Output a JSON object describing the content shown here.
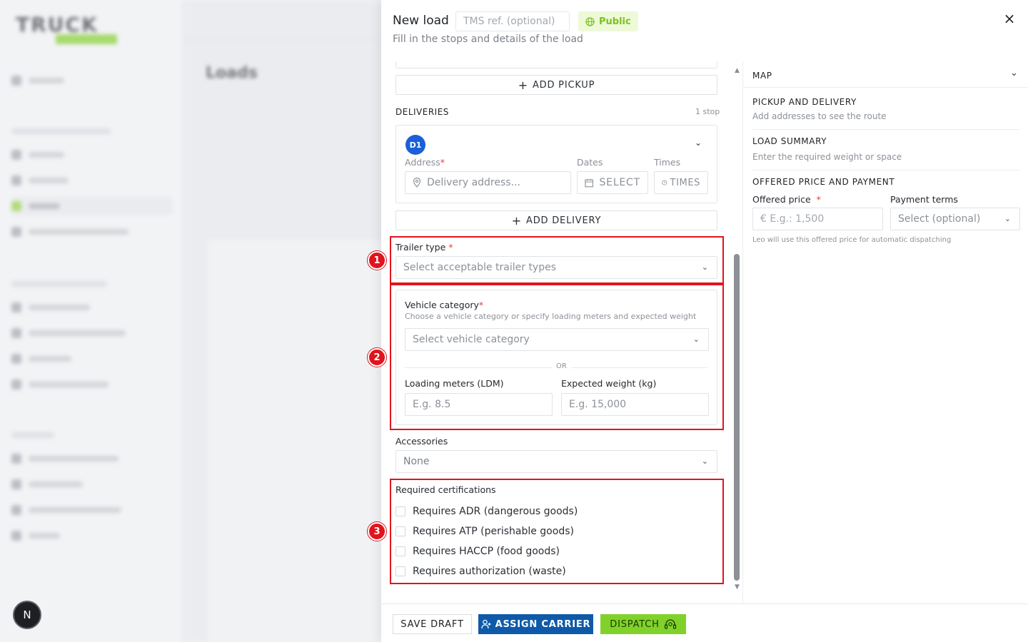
{
  "drawer": {
    "title": "New load",
    "tms_placeholder": "TMS ref. (optional)",
    "public_badge": "Public",
    "subtitle": "Fill in the stops and details of the load",
    "close_icon": "×"
  },
  "form": {
    "add_pickup": "ADD PICKUP",
    "deliveries_label": "DELIVERIES",
    "deliveries_count": "1 stop",
    "delivery": {
      "badge": "D1",
      "address_label": "Address",
      "address_placeholder": "Delivery address...",
      "dates_label": "Dates",
      "dates_button": "SELECT",
      "times_label": "Times",
      "times_button": "TIMES"
    },
    "add_delivery": "ADD DELIVERY",
    "trailer_type": {
      "label": "Trailer type",
      "placeholder": "Select acceptable trailer types"
    },
    "vehicle_category": {
      "label": "Vehicle category",
      "hint": "Choose a vehicle category or specify loading meters and expected weight",
      "placeholder": "Select vehicle category",
      "or_text": "OR",
      "ldm_label": "Loading meters (LDM)",
      "ldm_placeholder": "E.g. 8.5",
      "weight_label": "Expected weight (kg)",
      "weight_placeholder": "E.g. 15,000"
    },
    "accessories": {
      "label": "Accessories",
      "value": "None"
    },
    "certifications": {
      "label": "Required certifications",
      "items": [
        "Requires ADR (dangerous goods)",
        "Requires ATP (perishable goods)",
        "Requires HACCP (food goods)",
        "Requires authorization (waste)"
      ]
    },
    "required_mark": "*"
  },
  "annotations": [
    "1",
    "2",
    "3"
  ],
  "right_panel": {
    "map_label": "MAP",
    "pickup_delivery_title": "PICKUP AND DELIVERY",
    "pickup_delivery_sub": "Add addresses to see the route",
    "load_summary_title": "LOAD SUMMARY",
    "load_summary_sub": "Enter the required weight or space",
    "price_title": "OFFERED PRICE AND PAYMENT",
    "offered_price_label": "Offered price",
    "offered_price_placeholder": "€  E.g.: 1,500",
    "payment_terms_label": "Payment terms",
    "payment_terms_placeholder": "Select (optional)",
    "price_hint": "Leo will use this offered price for automatic dispatching"
  },
  "footer": {
    "save_draft": "SAVE DRAFT",
    "assign_carrier": "ASSIGN CARRIER",
    "dispatch": "DISPATCH"
  },
  "background": {
    "logo": "TRUCK",
    "avatar_initial": "N",
    "page_title": "Loads"
  },
  "colors": {
    "accent_blue": "#0f5aa8",
    "accent_green": "#80d22a",
    "annotation_red": "#e0141c",
    "badge_blue": "#1b5fd9"
  }
}
